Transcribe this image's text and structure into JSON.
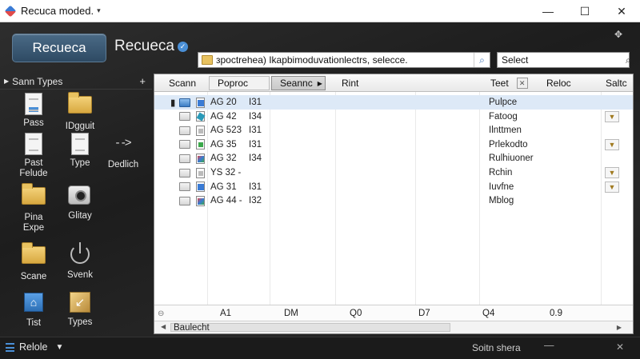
{
  "window": {
    "title": "Recuca moded.",
    "minimize": "—",
    "maximize": "☐",
    "close": "✕"
  },
  "header": {
    "button_label": "Recueca",
    "title": "Recueca",
    "path_value": "зpoctrehea) Ikapbimoduvationlectrs, selecce.",
    "search_placeholder": "Select"
  },
  "sidebar": {
    "title": "Sann Types",
    "items": [
      {
        "label": "Pass",
        "icon": "document-icon"
      },
      {
        "label": "IDgguit",
        "icon": "folder-icon"
      },
      {
        "label": "Past\nFelude",
        "icon": "document-icon"
      },
      {
        "label": "Type",
        "icon": "document-icon"
      },
      {
        "label": "Dedlich",
        "icon": "arrow-right-icon"
      },
      {
        "label": "Pina\nExpe",
        "icon": "folder-icon"
      },
      {
        "label": "Glitay",
        "icon": "camera-icon"
      },
      {
        "label": "Scane",
        "icon": "folder-icon"
      },
      {
        "label": "Svenk",
        "icon": "power-icon"
      },
      {
        "label": "Tist",
        "icon": "home-icon"
      },
      {
        "label": "Types",
        "icon": "wand-icon"
      }
    ]
  },
  "columns": [
    "Scann",
    "Poproc",
    "Seannc",
    "Rint",
    "Teet",
    "Reloc",
    "Saltc"
  ],
  "rows": [
    {
      "col1": "AG 20",
      "col2": "I31",
      "teet": "Pulpce",
      "action": false,
      "selected": true,
      "icon": "blue"
    },
    {
      "col1": "AG 42",
      "col2": "I34",
      "teet": "Fatoog",
      "action": true,
      "selected": false,
      "icon": "teal"
    },
    {
      "col1": "AG 523",
      "col2": "I31",
      "teet": "Ilnttmen",
      "action": false,
      "selected": false,
      "icon": "gray"
    },
    {
      "col1": "AG 35",
      "col2": "I31",
      "teet": "Prlekodto",
      "action": true,
      "selected": false,
      "icon": "green"
    },
    {
      "col1": "AG 32",
      "col2": "I34",
      "teet": "Rulhiuoner",
      "action": false,
      "selected": false,
      "icon": "multi"
    },
    {
      "col1": "YS 32 -",
      "col2": "",
      "teet": "Rchin",
      "action": true,
      "selected": false,
      "icon": "gray"
    },
    {
      "col1": "AG 31",
      "col2": "I31",
      "teet": "Iuvfne",
      "action": true,
      "selected": false,
      "icon": "blue"
    },
    {
      "col1": "AG 44 -",
      "col2": "I32",
      "teet": "Mblog",
      "action": false,
      "selected": false,
      "icon": "multi"
    }
  ],
  "footer": {
    "c1": "A1",
    "c2": "DM",
    "c3": "Q0",
    "c4": "D7",
    "c5": "Q4",
    "c6": "0.9"
  },
  "hscroll": {
    "label": "Baulecht"
  },
  "status": {
    "left": "Relole",
    "middle": "Soitn shera",
    "dash": "—",
    "close": "✕"
  }
}
